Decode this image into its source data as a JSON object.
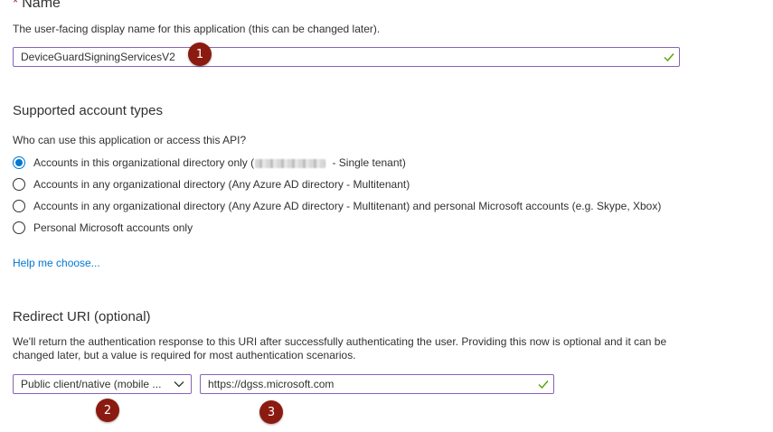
{
  "name_section": {
    "required_marker": "*",
    "heading": "Name",
    "description": "The user-facing display name for this application (this can be changed later).",
    "field_value": "DeviceGuardSigningServicesV2"
  },
  "account_types": {
    "heading": "Supported account types",
    "question": "Who can use this application or access this API?",
    "options": [
      {
        "label_before": "Accounts in this organizational directory only (",
        "label_after": " - Single tenant)",
        "selected": true
      },
      {
        "label": "Accounts in any organizational directory (Any Azure AD directory - Multitenant)",
        "selected": false
      },
      {
        "label": "Accounts in any organizational directory (Any Azure AD directory - Multitenant) and personal Microsoft accounts (e.g. Skype, Xbox)",
        "selected": false
      },
      {
        "label": "Personal Microsoft accounts only",
        "selected": false
      }
    ],
    "help_link": "Help me choose..."
  },
  "redirect": {
    "heading": "Redirect URI (optional)",
    "description": "We'll return the authentication response to this URI after successfully authenticating the user. Providing this now is optional and it can be changed later, but a value is required for most authentication scenarios.",
    "platform_selected": "Public client/native (mobile ...",
    "uri_value": "https://dgss.microsoft.com"
  },
  "callouts": [
    "1",
    "2",
    "3"
  ],
  "colors": {
    "focus_border": "#8764b8",
    "accent_blue": "#0078d4",
    "valid_check": "#57a300",
    "callout_badge": "#8b1a10",
    "required_star": "#a4262c"
  },
  "icons": [
    "checkmark-icon",
    "chevron-down-icon"
  ]
}
